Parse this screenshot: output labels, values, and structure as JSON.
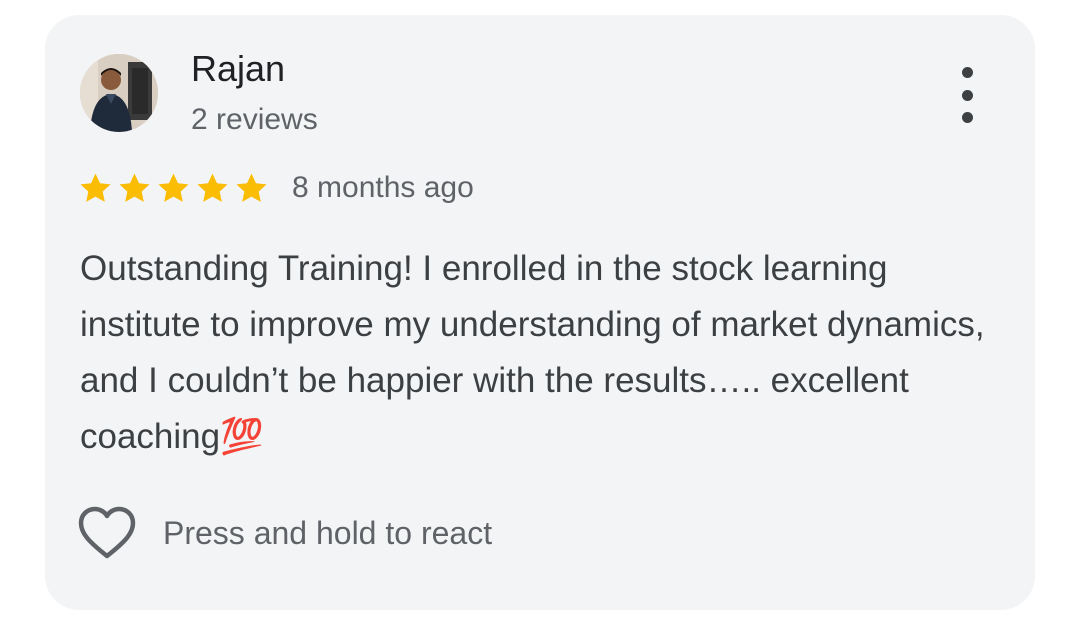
{
  "review": {
    "author_name": "Rajan",
    "review_count": "2 reviews",
    "rating": 5,
    "rating_max": 5,
    "time_ago": "8 months ago",
    "text": "Outstanding Training! I enrolled in the stock learning institute to improve my understanding of market dynamics, and I couldn’t be happier with the results….. excellent coaching💯"
  },
  "reaction": {
    "label": "Press and hold to react",
    "icon": "heart-outline-icon"
  },
  "menu": {
    "icon": "more-vert-icon"
  },
  "colors": {
    "card_background": "#f3f4f6",
    "star": "#fbbc04",
    "primary_text": "#202124",
    "secondary_text": "#5f6368",
    "body_text": "#3c4043"
  }
}
